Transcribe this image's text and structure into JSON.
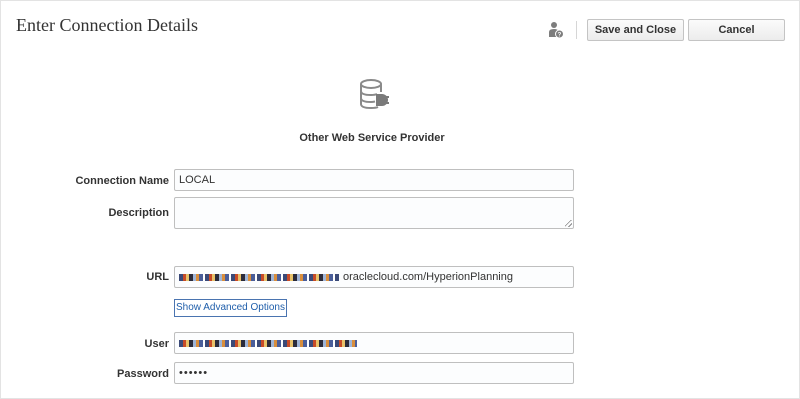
{
  "header": {
    "title": "Enter Connection Details",
    "save_label": "Save and Close",
    "cancel_label": "Cancel",
    "help_icon": "user-help-icon"
  },
  "provider": {
    "icon": "database-plug-icon",
    "name": "Other Web Service Provider"
  },
  "form": {
    "connection_name": {
      "label": "Connection Name",
      "value": "LOCAL"
    },
    "description": {
      "label": "Description",
      "value": ""
    },
    "url": {
      "label": "URL",
      "value_visible_suffix": "oraclecloud.com/HyperionPlanning"
    },
    "advanced_link": "Show Advanced Options",
    "user": {
      "label": "User"
    },
    "password": {
      "label": "Password",
      "value": "••••••"
    }
  }
}
